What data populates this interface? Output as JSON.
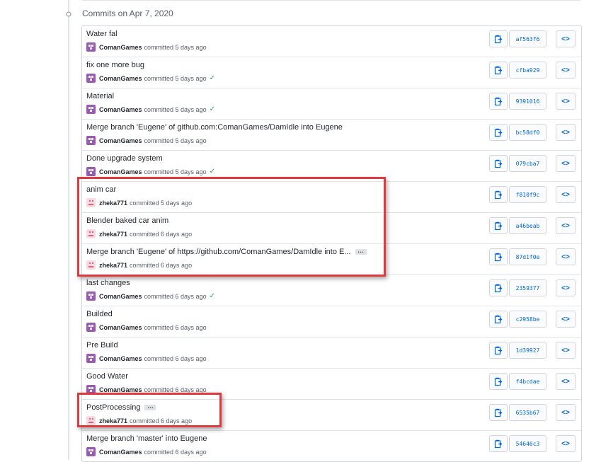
{
  "group": {
    "heading": "Commits on Apr 7, 2020"
  },
  "accent_color": "#0366d6",
  "highlight_color": "#e0393e",
  "commits": [
    {
      "title": "Water fal",
      "author": "ComanGames",
      "time": "committed 5 days ago",
      "sha": "af563f6",
      "verified": false,
      "avatar": "purple",
      "truncated": false
    },
    {
      "title": "fix one more bug",
      "author": "ComanGames",
      "time": "committed 5 days ago",
      "sha": "cfba929",
      "verified": true,
      "avatar": "purple",
      "truncated": false
    },
    {
      "title": "Material",
      "author": "ComanGames",
      "time": "committed 5 days ago",
      "sha": "9391016",
      "verified": true,
      "avatar": "purple",
      "truncated": false
    },
    {
      "title": "Merge branch 'Eugene' of github.com:ComanGames/DamIdle into Eugene",
      "author": "ComanGames",
      "time": "committed 5 days ago",
      "sha": "bc58df0",
      "verified": false,
      "avatar": "purple",
      "truncated": false
    },
    {
      "title": "Done upgrade system",
      "author": "ComanGames",
      "time": "committed 5 days ago",
      "sha": "079cba7",
      "verified": true,
      "avatar": "purple",
      "truncated": false
    },
    {
      "title": "anim car",
      "author": "zheka771",
      "time": "committed 5 days ago",
      "sha": "f810f9c",
      "verified": false,
      "avatar": "pink",
      "truncated": false
    },
    {
      "title": "Blender baked car anim",
      "author": "zheka771",
      "time": "committed 6 days ago",
      "sha": "a46beab",
      "verified": false,
      "avatar": "pink",
      "truncated": false
    },
    {
      "title": "Merge branch 'Eugene' of https://github.com/ComanGames/DamIdle into E...",
      "author": "zheka771",
      "time": "committed 6 days ago",
      "sha": "87d1f0e",
      "verified": false,
      "avatar": "pink",
      "truncated": true
    },
    {
      "title": "last changes",
      "author": "ComanGames",
      "time": "committed 6 days ago",
      "sha": "2359377",
      "verified": true,
      "avatar": "purple",
      "truncated": false
    },
    {
      "title": "Builded",
      "author": "ComanGames",
      "time": "committed 6 days ago",
      "sha": "c2958be",
      "verified": false,
      "avatar": "purple",
      "truncated": false
    },
    {
      "title": "Pre Build",
      "author": "ComanGames",
      "time": "committed 6 days ago",
      "sha": "1d39927",
      "verified": false,
      "avatar": "purple",
      "truncated": false
    },
    {
      "title": "Good Water",
      "author": "ComanGames",
      "time": "committed 6 days ago",
      "sha": "f4bcdae",
      "verified": false,
      "avatar": "purple",
      "truncated": false
    },
    {
      "title": "PostProcessing",
      "author": "zheka771",
      "time": "committed 6 days ago",
      "sha": "6535b67",
      "verified": false,
      "avatar": "pink",
      "truncated": true
    },
    {
      "title": "Merge branch 'master' into Eugene",
      "author": "ComanGames",
      "time": "committed 6 days ago",
      "sha": "54646c3",
      "verified": false,
      "avatar": "purple",
      "truncated": false
    }
  ],
  "ellipsis_label": "…",
  "check_glyph": "✓",
  "browse_glyph": "<>"
}
